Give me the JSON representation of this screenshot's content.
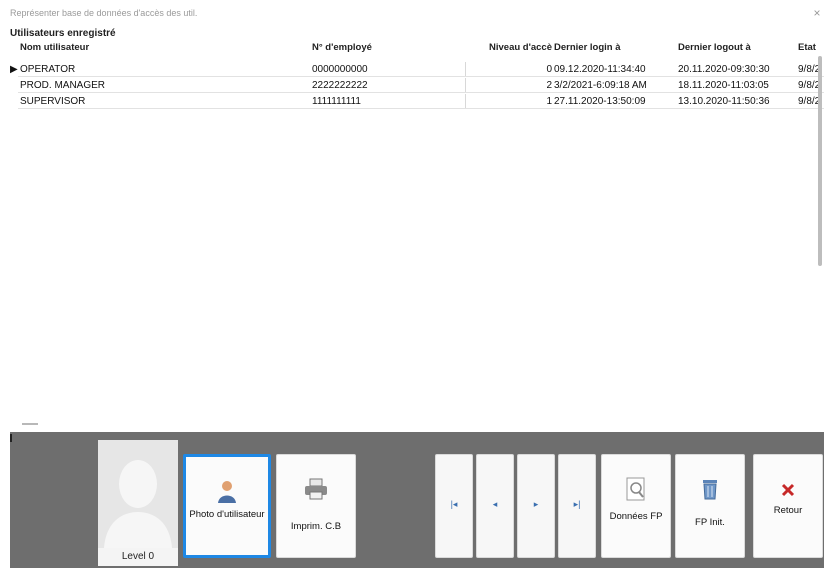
{
  "window": {
    "title": "Représenter base de données d'accès des util.",
    "close_label": "×"
  },
  "section_label": "Utilisateurs enregistré",
  "grid": {
    "columns": [
      "Nom utilisateur",
      "N° d'employé",
      "Niveau d'accè",
      "Dernier login à",
      "Dernier logout à",
      "Etat"
    ],
    "rows": [
      {
        "name": "OPERATOR",
        "employee": "0000000000",
        "level": "0",
        "last_login": "09.12.2020-11:34:40",
        "last_logout": "20.11.2020-09:30:30",
        "state": "9/8/2",
        "current": true
      },
      {
        "name": "PROD. MANAGER",
        "employee": "2222222222",
        "level": "2",
        "last_login": "3/2/2021-6:09:18 AM",
        "last_logout": "18.11.2020-11:03:05",
        "state": "9/8/2",
        "current": false
      },
      {
        "name": "SUPERVISOR",
        "employee": "1111111111",
        "level": "1",
        "last_login": "27.11.2020-13:50:09",
        "last_logout": "13.10.2020-11:50:36",
        "state": "9/8/2",
        "current": false
      }
    ]
  },
  "avatar": {
    "level_label": "Level 0"
  },
  "buttons": {
    "user_photo": "Photo d'utilisateur",
    "print_cb": "Imprim. C.B",
    "fp_data": "Données FP",
    "fp_init": "FP Init.",
    "back": "Retour"
  },
  "nav": {
    "first": "|◂",
    "prev": "◂",
    "next": "▸",
    "last": "▸|"
  },
  "colors": {
    "panel_bg": "#6e6e6e",
    "active_border": "#1e88e5",
    "back_icon": "#c62828",
    "nav_glyph": "#3a6fb0"
  }
}
